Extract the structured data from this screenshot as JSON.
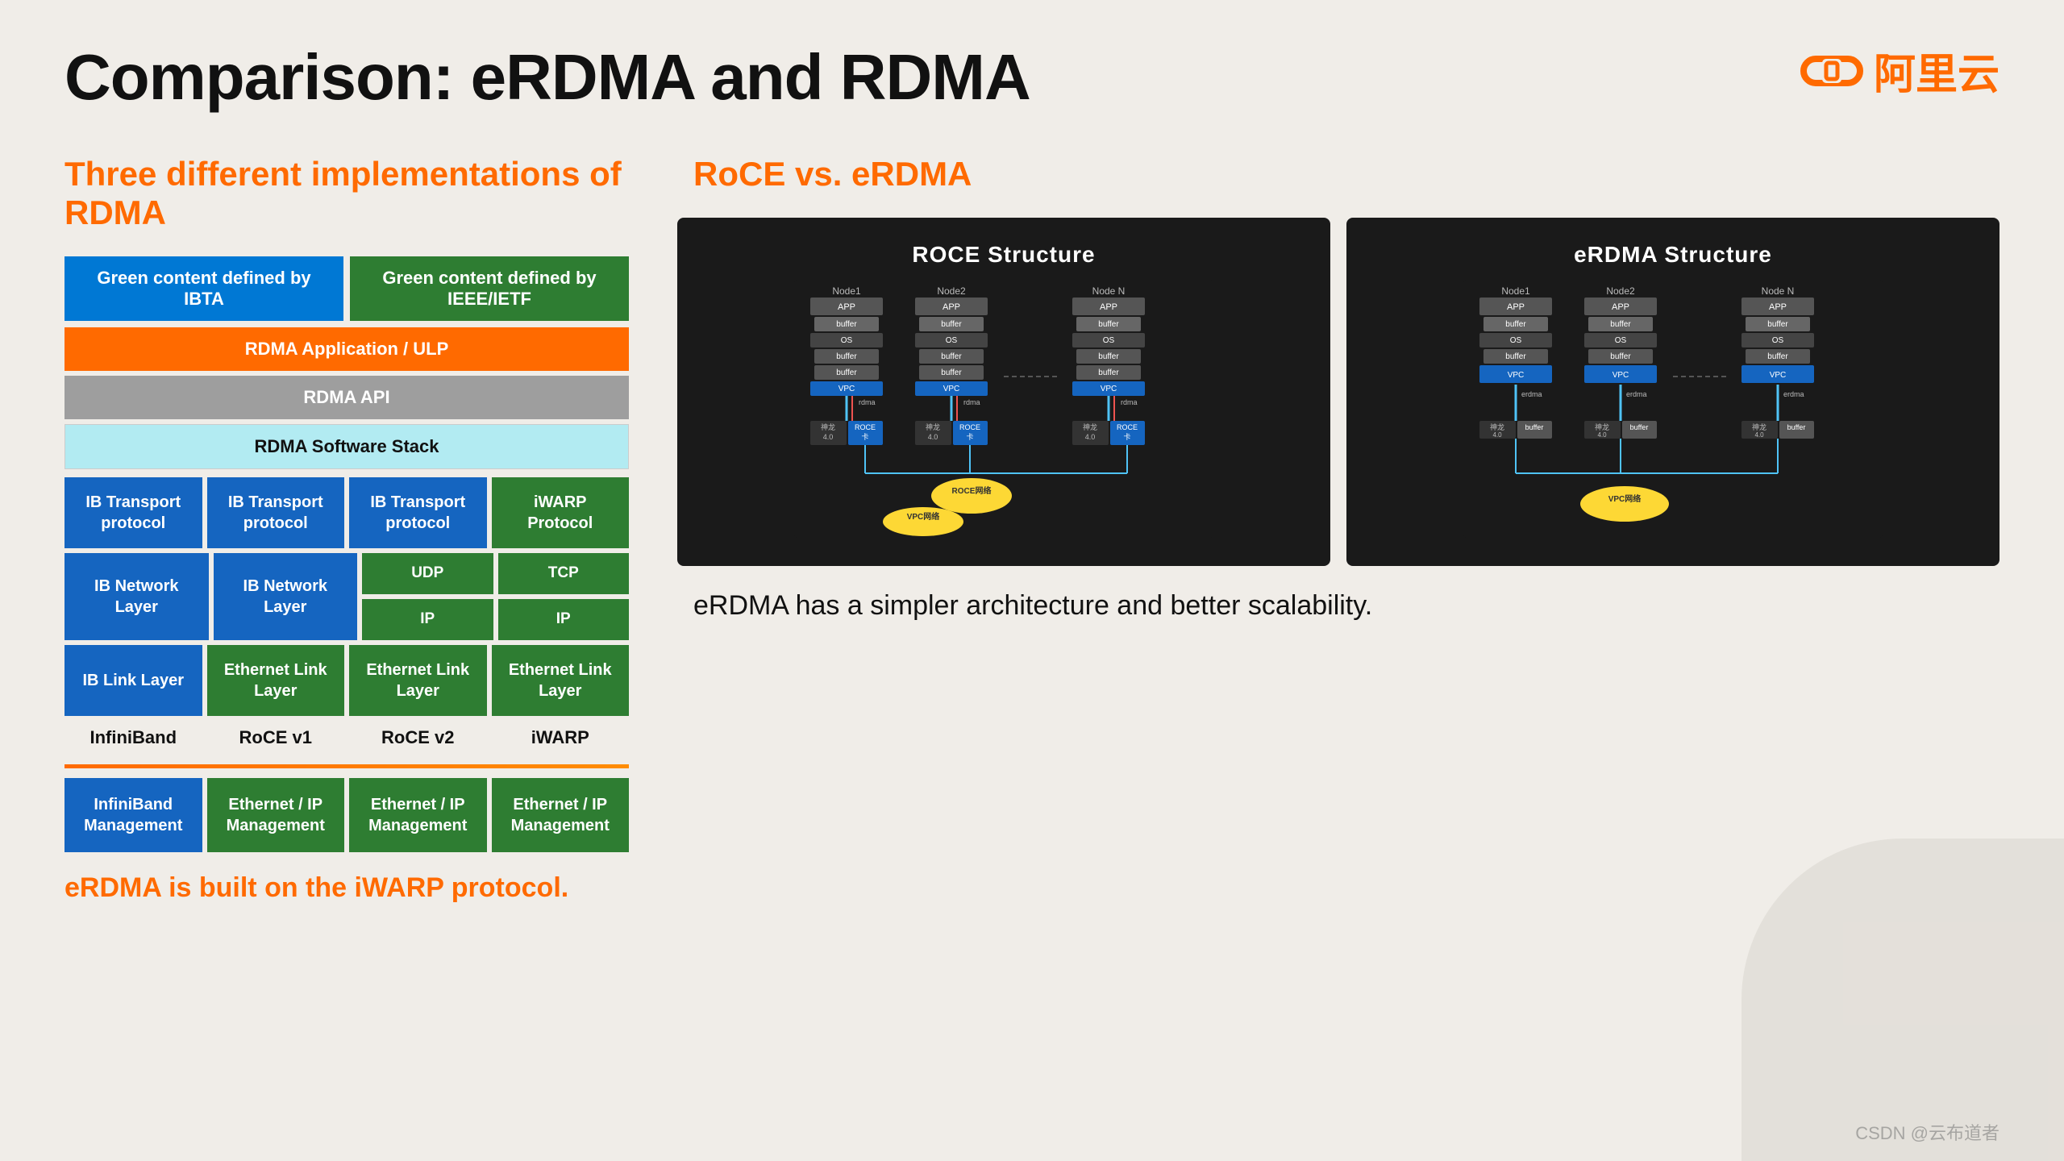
{
  "header": {
    "title": "Comparison: eRDMA and RDMA",
    "logo_text": "阿里云"
  },
  "left": {
    "section_title": "Three different implementations of RDMA",
    "legend": {
      "ibta_label": "Green content defined by IBTA",
      "ieee_label": "Green content defined by IEEE/IETF"
    },
    "rows": {
      "application": "RDMA Application / ULP",
      "api": "RDMA API",
      "software_stack": "RDMA Software Stack"
    },
    "transport_row": [
      {
        "label": "IB Transport\nprotocol",
        "color": "blue"
      },
      {
        "label": "IB Transport\nprotocol",
        "color": "blue"
      },
      {
        "label": "IB Transport\nprotocol",
        "color": "blue"
      },
      {
        "label": "iWARP\nProtocol",
        "color": "green"
      }
    ],
    "network_col1": "IB Network Layer",
    "network_col2": "IB Network Layer",
    "network_stacked": [
      "UDP",
      "TCP"
    ],
    "network_stacked2": [
      "IP",
      "IP"
    ],
    "link_col1": "IB Link Layer",
    "link_col2": "Ethernet Link Layer",
    "link_col3": "Ethernet Link Layer",
    "link_col4": "Ethernet Link Layer",
    "col_headers": [
      "InfiniBand",
      "RoCE v1",
      "RoCE v2",
      "iWARP"
    ],
    "mgmt": [
      {
        "label": "InfiniBand\nManagement",
        "color": "blue"
      },
      {
        "label": "Ethernet / IP\nManagement",
        "color": "green"
      },
      {
        "label": "Ethernet / IP\nManagement",
        "color": "green"
      },
      {
        "label": "Ethernet / IP\nManagement",
        "color": "green"
      }
    ],
    "bottom_label": "eRDMA is built on the iWARP protocol."
  },
  "right": {
    "section_title": "RoCE vs. eRDMA",
    "roce_diagram_title": "ROCE Structure",
    "erdma_diagram_title": "eRDMA Structure",
    "bottom_text": "eRDMA has a simpler architecture and better scalability."
  },
  "footer": {
    "text": "CSDN @云布道者"
  }
}
